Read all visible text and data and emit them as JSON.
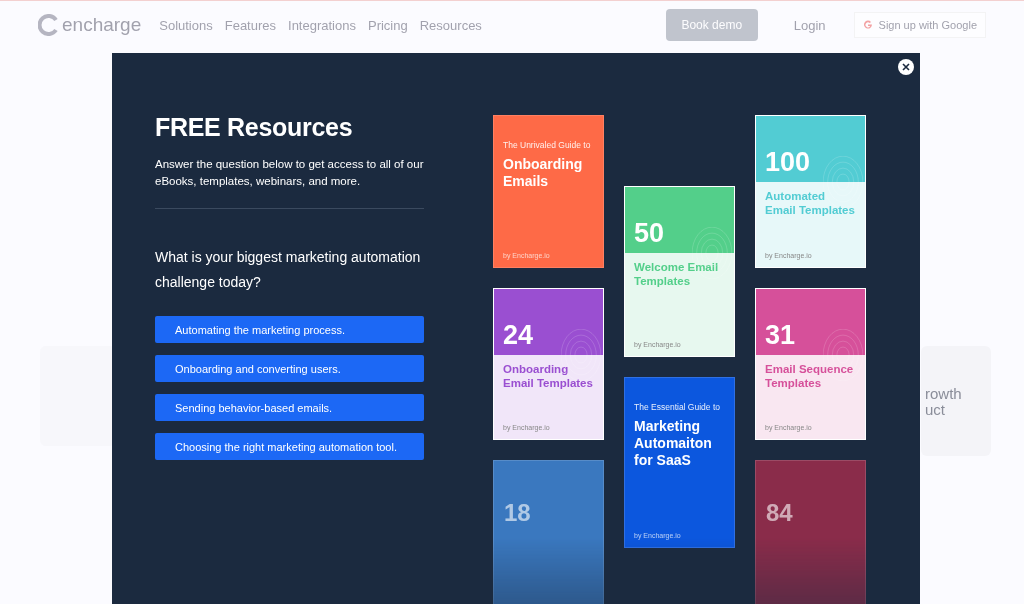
{
  "nav": {
    "logo": "encharge",
    "links": [
      "Solutions",
      "Features",
      "Integrations",
      "Pricing",
      "Resources"
    ],
    "book_demo": "Book demo",
    "login": "Login",
    "google": "Sign up with Google"
  },
  "background_fragments": [
    "rowth",
    "uct"
  ],
  "modal": {
    "title": "FREE Resources",
    "intro": "Answer the question below to get access to all of our eBooks, templates, webinars, and more.",
    "question": "What is your biggest marketing automation challenge today?",
    "answers": [
      "Automating the marketing process.",
      "Onboarding and converting users.",
      "Sending behavior-based emails.",
      "Choosing the right marketing automation tool."
    ],
    "book_columns": [
      [
        {
          "kind": "cover",
          "color": "#fe6a47",
          "subtitle": "The Unrivaled Guide to",
          "title": "Onboarding Emails",
          "byline": "by Encharge.io"
        },
        {
          "kind": "split",
          "color": "#9a4fd1",
          "number": "24",
          "title": "Onboarding Email Templates",
          "byline": "by Encharge.io"
        },
        {
          "kind": "faded",
          "color": "#3a78bf",
          "number": "18"
        }
      ],
      [
        {
          "kind": "split",
          "color": "#53cf8a",
          "number": "50",
          "title": "Welcome Email Templates",
          "byline": "by Encharge.io"
        },
        {
          "kind": "cover",
          "color": "#0c57de",
          "subtitle": "The Essential Guide to",
          "title": "Marketing Automaiton for SaaS",
          "byline": "by Encharge.io"
        }
      ],
      [
        {
          "kind": "split",
          "color": "#52ccd3",
          "number": "100",
          "title": "Automated Email Templates",
          "byline": "by Encharge.io"
        },
        {
          "kind": "split",
          "color": "#d6509a",
          "number": "31",
          "title": "Email Sequence Templates",
          "byline": "by Encharge.io"
        },
        {
          "kind": "faded",
          "color": "#8a2c4a",
          "number": "84"
        }
      ]
    ]
  }
}
